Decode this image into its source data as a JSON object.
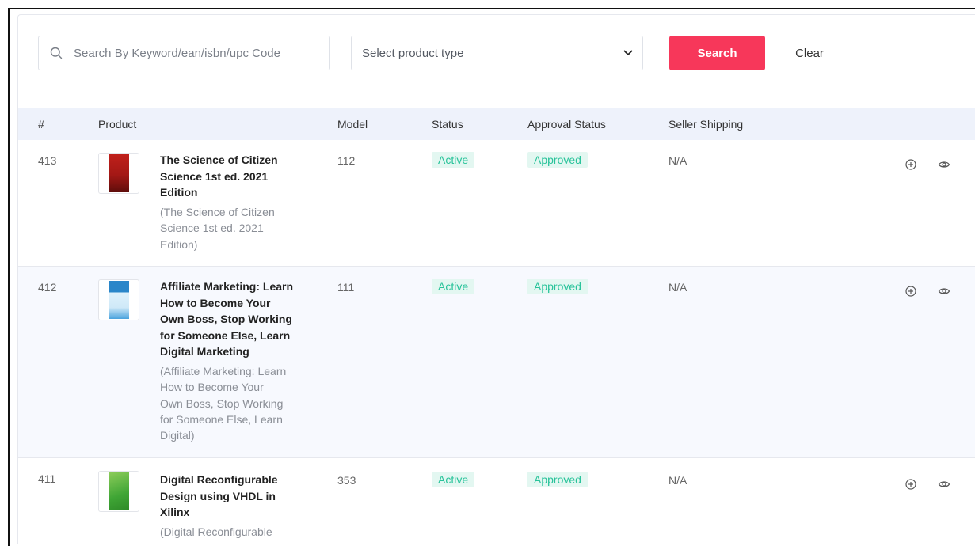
{
  "filters": {
    "search_placeholder": "Search By Keyword/ean/isbn/upc Code",
    "search_value": "",
    "product_type_label": "Select product type",
    "search_button": "Search",
    "clear_button": "Clear"
  },
  "table": {
    "headers": {
      "index": "#",
      "product": "Product",
      "model": "Model",
      "status": "Status",
      "approval_status": "Approval Status",
      "seller_shipping": "Seller Shipping"
    },
    "rows": [
      {
        "id": "413",
        "title_lines": [
          "The Science of Citizen",
          "Science 1st ed. 2021",
          "Edition"
        ],
        "subtitle_lines": [
          "(The Science of Citizen",
          "Science 1st ed. 2021",
          "Edition)"
        ],
        "model": "112",
        "status": "Active",
        "approval": "Approved",
        "shipping": "N/A",
        "cover_colors": [
          "#c0201b",
          "#7a1210"
        ]
      },
      {
        "id": "412",
        "title_lines": [
          "Affiliate Marketing: Learn",
          "How to Become Your",
          "Own Boss, Stop Working",
          "for Someone Else, Learn",
          "Digital Marketing"
        ],
        "subtitle_lines": [
          "(Affiliate Marketing: Learn",
          "How to Become Your",
          "Own Boss, Stop Working",
          "for Someone Else, Learn",
          "Digital)"
        ],
        "model": "111",
        "status": "Active",
        "approval": "Approved",
        "shipping": "N/A",
        "cover_colors": [
          "#2a86c9",
          "#bfe3f7"
        ]
      },
      {
        "id": "411",
        "title_lines": [
          "Digital Reconfigurable",
          "Design using VHDL in",
          "Xilinx"
        ],
        "subtitle_lines": [
          "(Digital Reconfigurable"
        ],
        "model": "353",
        "status": "Active",
        "approval": "Approved",
        "shipping": "N/A",
        "cover_colors": [
          "#3fa535",
          "#8ccc5a"
        ]
      }
    ]
  },
  "colors": {
    "accent": "#f7375a",
    "badge_text": "#28c39a",
    "badge_bg": "#e3f7f1",
    "header_bg": "#eef2fb"
  },
  "icons": {
    "search": "search-icon",
    "dropdown": "chevron-down-icon",
    "add": "plus-circle-icon",
    "view": "eye-icon"
  }
}
